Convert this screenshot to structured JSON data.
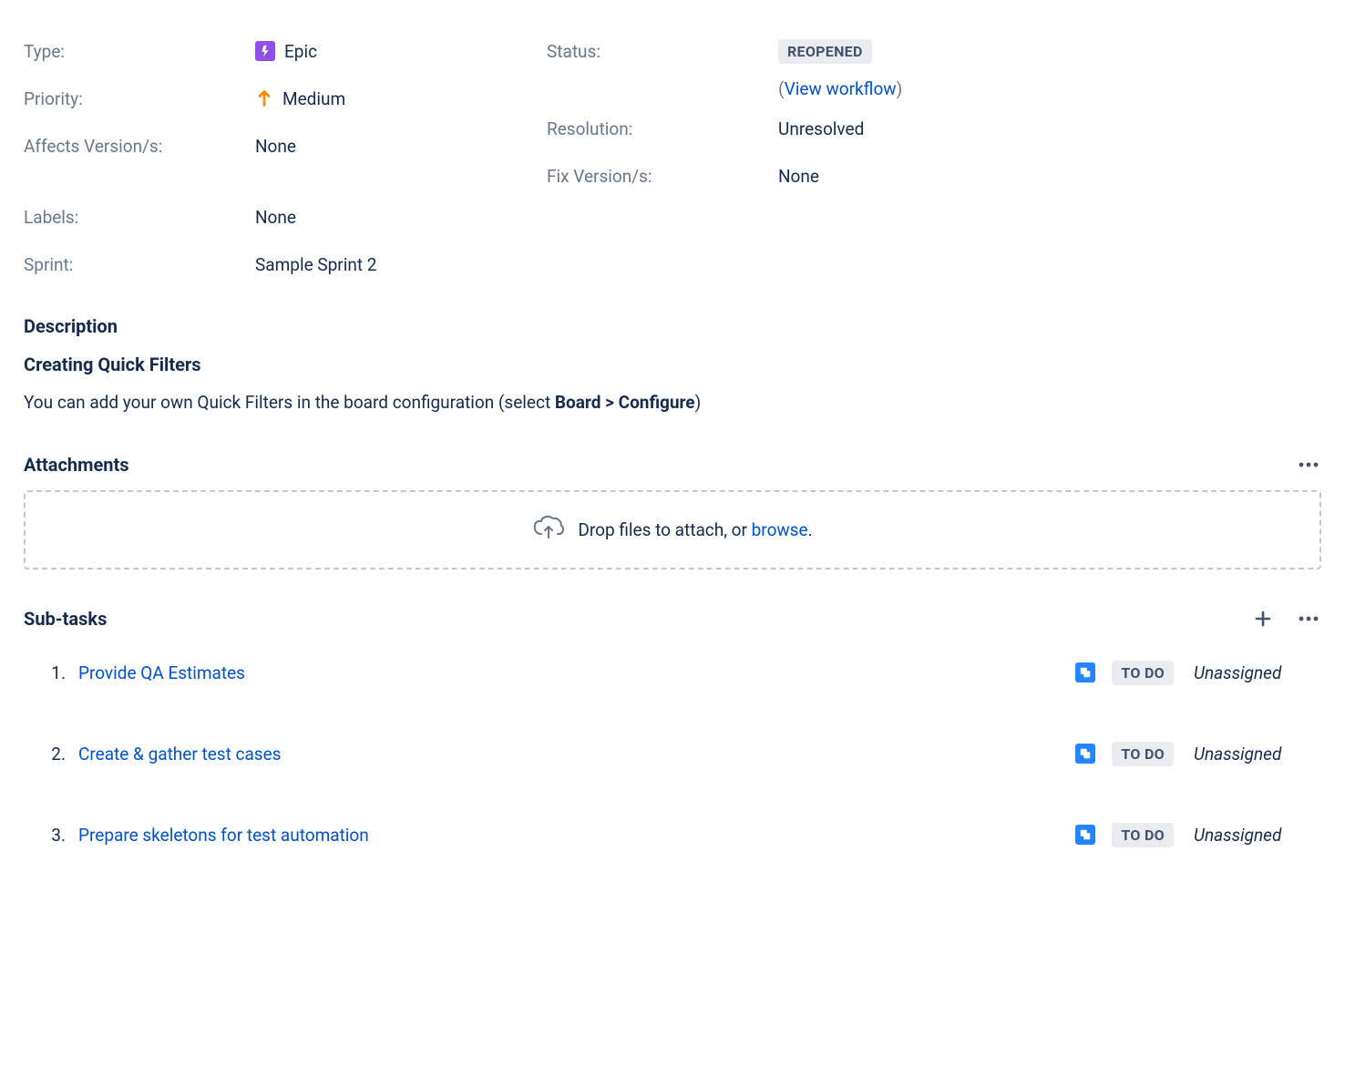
{
  "fields": {
    "type_label": "Type:",
    "type_value": "Epic",
    "priority_label": "Priority:",
    "priority_value": "Medium",
    "affects_label": "Affects Version/s:",
    "affects_value": "None",
    "labels_label": "Labels:",
    "labels_value": "None",
    "sprint_label": "Sprint:",
    "sprint_value": "Sample Sprint 2",
    "status_label": "Status:",
    "status_value": "REOPENED",
    "view_workflow": "View workflow",
    "resolution_label": "Resolution:",
    "resolution_value": "Unresolved",
    "fixversion_label": "Fix Version/s:",
    "fixversion_value": "None"
  },
  "description": {
    "heading": "Description",
    "title": "Creating Quick Filters",
    "text_before": "You can add your own Quick Filters in the board configuration (select ",
    "text_bold": "Board > Configure",
    "text_after": ")"
  },
  "attachments": {
    "heading": "Attachments",
    "drop_text": "Drop files to attach, or ",
    "browse": "browse",
    "period": "."
  },
  "subtasks": {
    "heading": "Sub-tasks",
    "items": [
      {
        "num": "1.",
        "title": "Provide QA Estimates",
        "status": "TO DO",
        "assignee": "Unassigned"
      },
      {
        "num": "2.",
        "title": "Create & gather test cases",
        "status": "TO DO",
        "assignee": "Unassigned"
      },
      {
        "num": "3.",
        "title": "Prepare skeletons for test automation",
        "status": "TO DO",
        "assignee": "Unassigned"
      }
    ]
  }
}
